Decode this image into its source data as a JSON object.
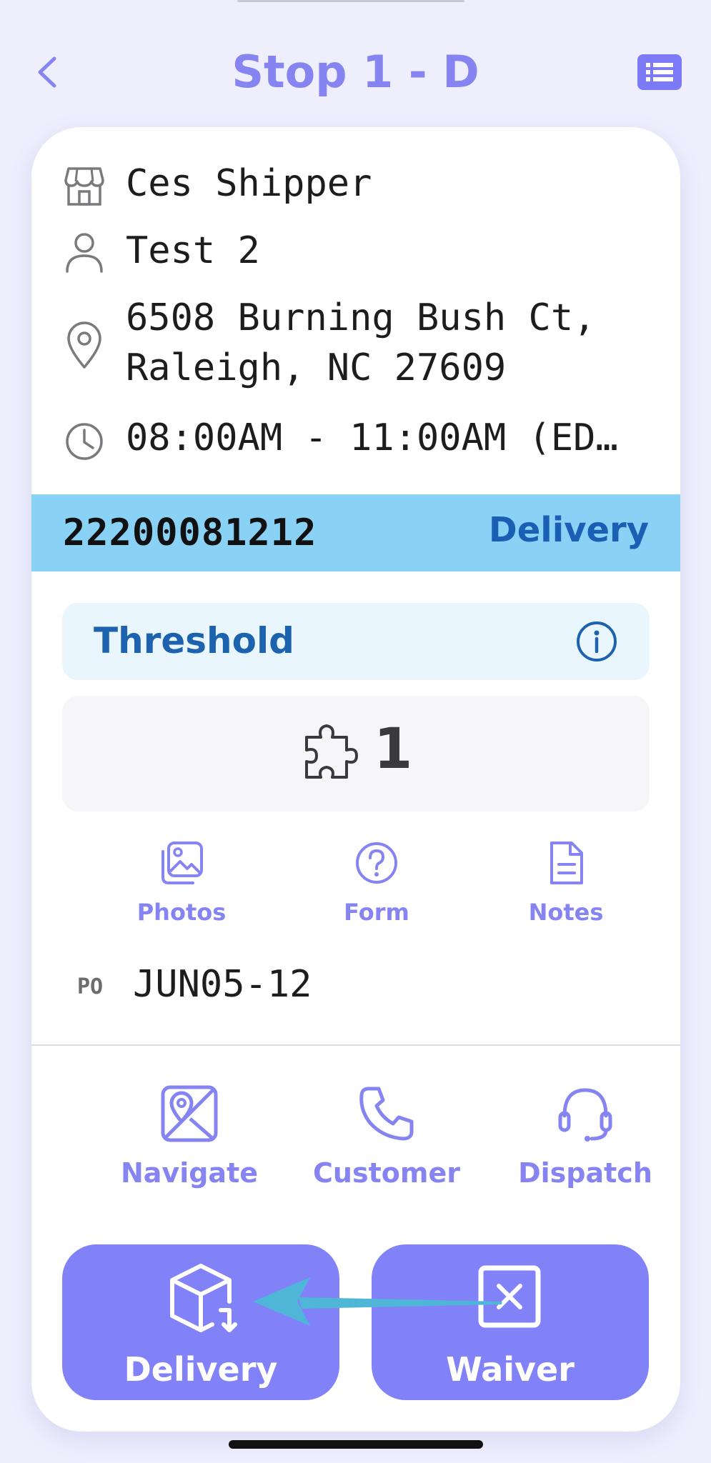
{
  "header": {
    "title": "Stop 1 - D"
  },
  "stop": {
    "shipper": "Ces Shipper",
    "contact": "Test 2",
    "address_line1": "6508 Burning Bush Ct,",
    "address_line2": "Raleigh, NC 27609",
    "time_window": "08:00AM - 11:00AM (ED…"
  },
  "order": {
    "number": "22200081212",
    "type": "Delivery"
  },
  "service": {
    "level": "Threshold"
  },
  "pieces": {
    "count": "1"
  },
  "attachments": [
    {
      "label": "Photos",
      "icon": "photos-icon"
    },
    {
      "label": "Form",
      "icon": "question-circle-icon"
    },
    {
      "label": "Notes",
      "icon": "document-icon"
    }
  ],
  "po": {
    "label": "PO",
    "value": "JUN05-12"
  },
  "contact_actions": [
    {
      "label": "Navigate",
      "icon": "map-pin-icon"
    },
    {
      "label": "Customer",
      "icon": "phone-icon"
    },
    {
      "label": "Dispatch",
      "icon": "headset-icon"
    }
  ],
  "buttons": {
    "delivery_label": "Delivery",
    "waiver_label": "Waiver"
  },
  "colors": {
    "accent": "#8684F1",
    "order_bar": "#8AD1F6",
    "order_type": "#1A5FB4",
    "button_fill": "#8282F8",
    "background": "#EEEEFD"
  }
}
